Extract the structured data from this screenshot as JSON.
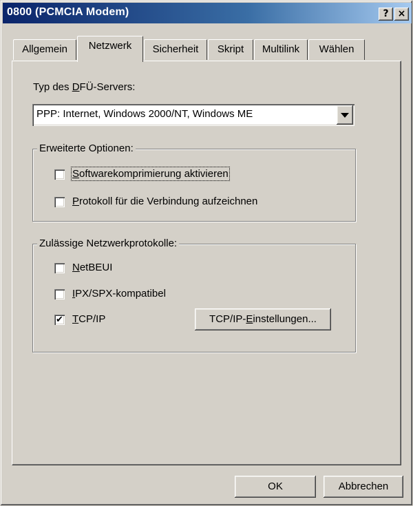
{
  "window": {
    "title": "0800 (PCMCIA Modem)",
    "help_label": "?",
    "close_label": "×"
  },
  "tabs": [
    {
      "label": "Allgemein",
      "active": false
    },
    {
      "label": "Netzwerk",
      "active": true
    },
    {
      "label": "Sicherheit",
      "active": false
    },
    {
      "label": "Skript",
      "active": false
    },
    {
      "label": "Multilink",
      "active": false
    },
    {
      "label": "Wählen",
      "active": false
    }
  ],
  "server_type": {
    "label_pre": "Typ des ",
    "label_accel": "D",
    "label_post": "FÜ-Servers:",
    "selected": "PPP: Internet, Windows 2000/NT, Windows ME"
  },
  "advanced": {
    "title": "Erweiterte Optionen:",
    "options": [
      {
        "accel": "S",
        "rest": "oftwarekomprimierung aktivieren",
        "checked": false
      },
      {
        "accel": "P",
        "rest": "rotokoll für die Verbindung aufzeichnen",
        "checked": false
      }
    ]
  },
  "protocols": {
    "title": "Zulässige Netzwerkprotokolle:",
    "items": [
      {
        "accel": "N",
        "rest": "etBEUI",
        "checked": false
      },
      {
        "accel": "I",
        "rest": "PX/SPX-kompatibel",
        "checked": false
      },
      {
        "accel": "T",
        "rest": "CP/IP",
        "checked": true
      }
    ],
    "settings_button": {
      "pre": "TCP/IP-",
      "accel": "E",
      "post": "instellungen..."
    }
  },
  "footer": {
    "ok_label": "OK",
    "cancel_label": "Abbrechen"
  }
}
